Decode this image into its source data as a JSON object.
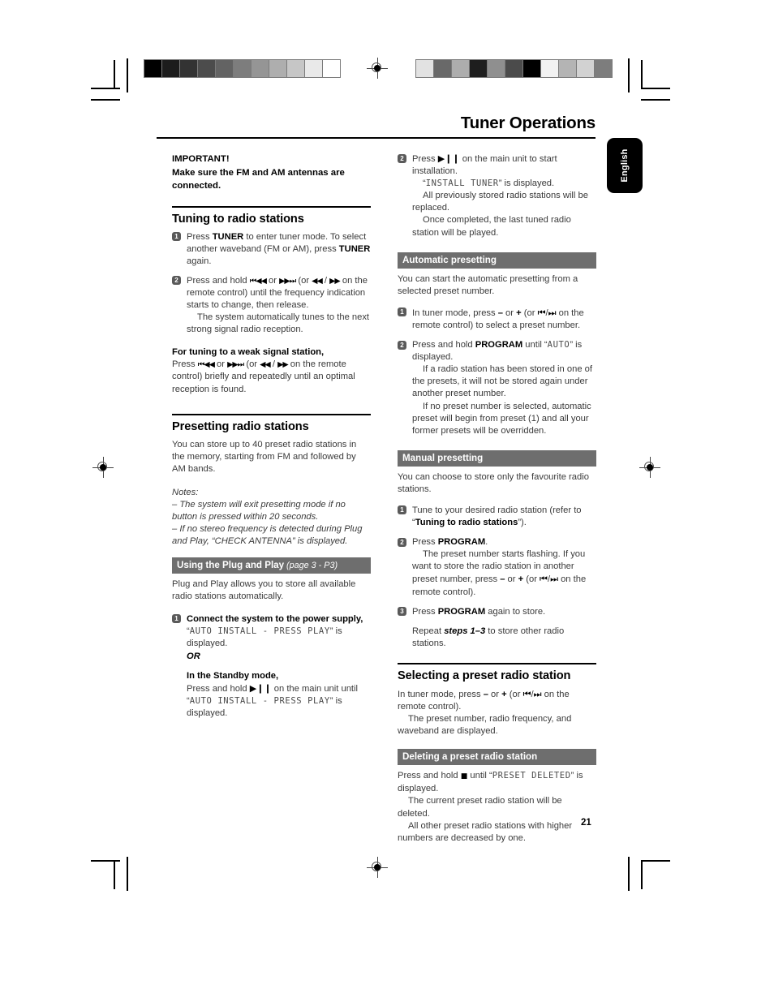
{
  "document": {
    "chapter_title": "Tuner Operations",
    "page_number": "21",
    "language_tab": "English"
  },
  "marks": {
    "colorbar_left": [
      "#000000",
      "#1c1c1c",
      "#333333",
      "#4c4c4c",
      "#636363",
      "#7d7d7d",
      "#959595",
      "#aeaeae",
      "#c6c6c6",
      "#e9e9e9",
      "#ffffff"
    ],
    "colorbar_right": [
      "#e2e2e2",
      "#696969",
      "#adadad",
      "#1e1e1e",
      "#8f8f8f",
      "#4b4b4b",
      "#000000",
      "#f2f2f2",
      "#b4b4b4",
      "#d2d2d2",
      "#7d7d7d"
    ]
  },
  "left_column": {
    "important": "IMPORTANT!\nMake sure the FM and AM antennas are connected.",
    "important_line1": "IMPORTANT!",
    "important_line2": "Make sure the FM and AM antennas are",
    "important_line3": "connected.",
    "tuning_heading": "Tuning to radio stations",
    "tuning_step1_num": "1",
    "tuning_step1_a": "Press ",
    "tuning_step1_b1": "TUNER",
    "tuning_step1_c": " to enter tuner mode. To select another waveband (FM or AM), press ",
    "tuning_step1_b2": "TUNER",
    "tuning_step1_d": " again.",
    "tuning_step2_num": "2",
    "tuning_step2_a": "Press and hold ",
    "tuning_step2_g1": "⏮◀◀",
    "tuning_step2_b": " or ",
    "tuning_step2_g2": "▶▶⏭",
    "tuning_step2_c": " (or ",
    "tuning_step2_g3": "◀◀",
    "tuning_step2_d": " / ",
    "tuning_step2_g4": "▶▶",
    "tuning_step2_e": " on the remote control) until the frequency indication starts to change, then release.",
    "tuning_step2_f": "The system automatically tunes to the next strong signal radio reception.",
    "weak_heading": "For tuning to a weak signal station,",
    "weak_a": "Press ",
    "weak_g1": "⏮◀◀",
    "weak_b": " or ",
    "weak_g2": "▶▶⏭",
    "weak_c": " (or ",
    "weak_g3": "◀◀",
    "weak_d": " / ",
    "weak_g4": "▶▶",
    "weak_e": " on the remote control) briefly and repeatedly until an optimal reception is found.",
    "presetting_heading": "Presetting radio stations",
    "presetting_body": "You can store up to 40 preset radio stations in the memory, starting from FM and followed by AM bands.",
    "notes_label": "Notes:",
    "note1": "–  The system will exit presetting mode if no button is pressed within 20 seconds.",
    "note2": "–  If no stereo frequency is detected during Plug and Play, “CHECK ANTENNA” is displayed.",
    "plugplay_bar_title": "Using the Plug and Play",
    "plugplay_bar_sub": " (page 3 - P3)",
    "plugplay_body": "Plug and Play allows you to store all available radio stations automatically.",
    "pp_step1_num": "1",
    "pp_step1_bold": "Connect the system to the power supply,",
    "pp_step1_quote_open": "“",
    "pp_step1_lcd": "AUTO INSTALL - PRESS PLAY",
    "pp_step1_quote_close": "” is",
    "pp_step1_tail": "displayed.",
    "pp_or": "OR",
    "pp_standby_bold": "In the Standby mode,",
    "pp_standby_a": "Press and hold ",
    "pp_standby_glyph": "▶❙❙",
    "pp_standby_b": " on the main unit until",
    "pp_standby_lcd": "AUTO INSTALL - PRESS PLAY",
    "pp_standby_c": "” is",
    "pp_standby_d": "displayed."
  },
  "right_column": {
    "step2_num": "2",
    "step2_a": "Press ",
    "step2_glyph": "▶❙❙",
    "step2_b": " on the main unit to start installation.",
    "step2_lcd": "INSTALL TUNER",
    "step2_lcd_tail": "” is displayed.",
    "step2_c": "All previously stored radio stations will be replaced.",
    "step2_d": "Once completed, the last tuned radio station will be played.",
    "auto_bar": "Automatic presetting",
    "auto_body": "You can start the automatic presetting from a selected preset number.",
    "auto_step1_num": "1",
    "auto_step1_a": "In tuner mode, press ",
    "auto_step1_minus": "–",
    "auto_step1_b": " or ",
    "auto_step1_plus": "+",
    "auto_step1_c": " (or ",
    "auto_step1_g1": "⏮",
    "auto_step1_slash": "/",
    "auto_step1_g2": "⏭",
    "auto_step1_d": " on the remote control) to select a preset number.",
    "auto_step2_num": "2",
    "auto_step2_a": "Press and hold ",
    "auto_step2_bold": "PROGRAM",
    "auto_step2_b": " until “",
    "auto_step2_lcd": "AUTO",
    "auto_step2_c": "” is displayed.",
    "auto_step2_d": "If a radio station has been stored in one of the presets, it will not be stored again under another preset number.",
    "auto_step2_e": "If no preset number is selected, automatic preset will begin from preset (1) and all your former presets will be overridden.",
    "manual_bar": "Manual presetting",
    "manual_body": "You can choose to store only the favourite radio stations.",
    "man_step1_num": "1",
    "man_step1_a": "Tune to your desired radio station (refer to “",
    "man_step1_bold": "Tuning to radio stations",
    "man_step1_b": "”).",
    "man_step2_num": "2",
    "man_step2_a": "Press ",
    "man_step2_bold": "PROGRAM",
    "man_step2_b": ".",
    "man_step2_c": "The preset number starts flashing. If you want to store the radio station in another preset number, press ",
    "man_step2_minus": "–",
    "man_step2_d": " or ",
    "man_step2_plus": "+",
    "man_step2_e": " (or ",
    "man_step2_g1": "⏮",
    "man_step2_slash": "/",
    "man_step2_g2": "⏭",
    "man_step2_f": " on the remote control).",
    "man_step3_num": "3",
    "man_step3_a": "Press ",
    "man_step3_bold": "PROGRAM",
    "man_step3_b": " again to store.",
    "man_repeat_a": "Repeat ",
    "man_repeat_bold": "steps 1–3",
    "man_repeat_b": " to store other radio stations.",
    "selecting_heading": "Selecting a preset radio station",
    "sel_a": "In tuner mode, press ",
    "sel_minus": "–",
    "sel_b": " or ",
    "sel_plus": "+",
    "sel_c": " (or ",
    "sel_g1": "⏮",
    "sel_slash": "/",
    "sel_g2": "⏭",
    "sel_d": " on the remote control).",
    "sel_e": "The preset number, radio frequency, and waveband are displayed.",
    "deleting_bar": "Deleting a preset radio station",
    "del_a": "Press and hold ",
    "del_glyph": "■",
    "del_b": " until “",
    "del_lcd": "PRESET DELETED",
    "del_c": "” is displayed.",
    "del_d": "The current preset radio station will be deleted.",
    "del_e": "All other preset radio stations with higher numbers are decreased by one."
  }
}
